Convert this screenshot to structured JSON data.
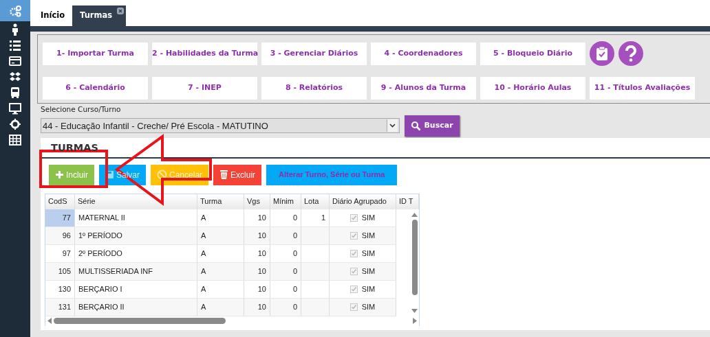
{
  "sidebar": {
    "items": [
      {
        "kind": "gears",
        "selected": true
      },
      {
        "kind": "person",
        "selected": false
      },
      {
        "kind": "list",
        "selected": false
      },
      {
        "kind": "card",
        "selected": false
      },
      {
        "kind": "boxes",
        "selected": false
      },
      {
        "kind": "bus",
        "selected": false
      },
      {
        "kind": "monitor",
        "selected": false
      },
      {
        "kind": "gear",
        "selected": false
      },
      {
        "kind": "table",
        "selected": false
      }
    ]
  },
  "tabs": [
    {
      "label": "Início",
      "selected": false,
      "closable": false
    },
    {
      "label": "Turmas",
      "selected": true,
      "closable": true
    }
  ],
  "menu_rows": [
    {
      "buttons": [
        "1- Importar Turma",
        "2 - Habilidades da Turma",
        "3 - Gerenciar Diários",
        "4 - Coordenadores",
        "5 - Bloqueio Diário"
      ],
      "icons": [
        {
          "kind": "clipboard"
        },
        {
          "kind": "help"
        }
      ]
    },
    {
      "buttons": [
        "6 - Calendário",
        "7 - INEP",
        "8 - Relatórios",
        "9 - Alunos da Turma",
        "10 - Horário Aulas",
        "11 - Títulos Avaliações"
      ],
      "icons": []
    }
  ],
  "filter": {
    "label": "Selecione Curso/Turno",
    "value": "44 - Educação Infantil - Creche/ Pré Escola - MATUTINO",
    "button": "Buscar"
  },
  "panel": {
    "title": "TURMAS",
    "toolbar": [
      {
        "kind": "add",
        "label": "Incluir",
        "disabled": false
      },
      {
        "kind": "save",
        "label": "Salvar",
        "disabled": true
      },
      {
        "kind": "cancel",
        "label": "Cancelar",
        "disabled": true
      },
      {
        "kind": "delete",
        "label": "Excluir",
        "disabled": false
      },
      {
        "kind": "text",
        "label": "Alterar Turno, Série ou Turma",
        "disabled": false
      }
    ]
  },
  "table": {
    "columns": [
      "CodS",
      "Série",
      "Turma",
      "Vgs",
      "Mínim",
      "Lota",
      "Diário Agrupado",
      "ID T"
    ],
    "rows": [
      {
        "cods": "77",
        "serie": "MATERNAL II",
        "turma": "A",
        "vgs": "10",
        "minimo": "0",
        "lota": "1",
        "agrupado": "SIM",
        "checked": true,
        "selected": true
      },
      {
        "cods": "96",
        "serie": "1º PERÍODO",
        "turma": "A",
        "vgs": "10",
        "minimo": "0",
        "lota": "",
        "agrupado": "SIM",
        "checked": true,
        "selected": false
      },
      {
        "cods": "97",
        "serie": "2º PERÍODO",
        "turma": "A",
        "vgs": "10",
        "minimo": "0",
        "lota": "",
        "agrupado": "SIM",
        "checked": true,
        "selected": false
      },
      {
        "cods": "105",
        "serie": "MULTISSERIADA INF",
        "turma": "A",
        "vgs": "10",
        "minimo": "0",
        "lota": "",
        "agrupado": "SIM",
        "checked": true,
        "selected": false
      },
      {
        "cods": "130",
        "serie": "BERÇARIO I",
        "turma": "A",
        "vgs": "10",
        "minimo": "0",
        "lota": "",
        "agrupado": "SIM",
        "checked": true,
        "selected": false
      },
      {
        "cods": "131",
        "serie": "BERÇARIO II",
        "turma": "A",
        "vgs": "10",
        "minimo": "0",
        "lota": "",
        "agrupado": "SIM",
        "checked": true,
        "selected": false
      }
    ]
  }
}
